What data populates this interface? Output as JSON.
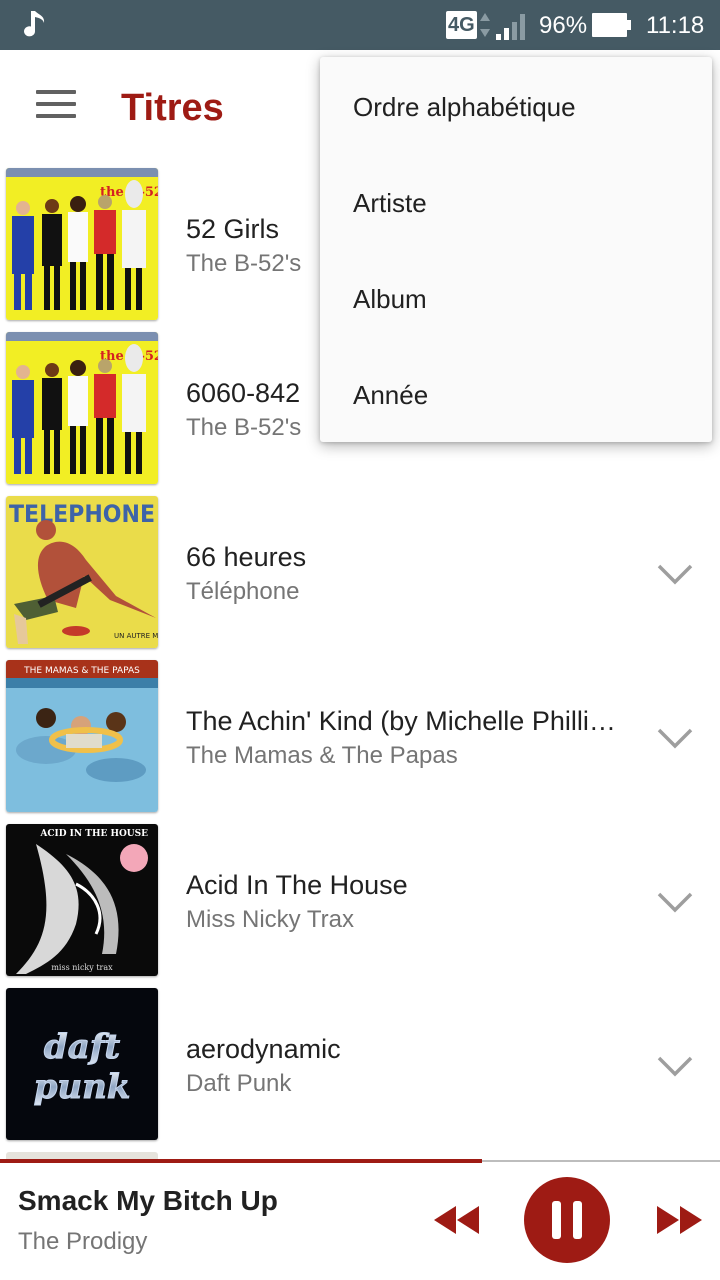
{
  "status_bar": {
    "network": "4G",
    "battery": "96%",
    "time": "11:18",
    "icons": [
      "music-note-icon",
      "signal-icon",
      "battery-icon"
    ]
  },
  "app_bar": {
    "title": "Titres",
    "menu_icon": "hamburger-menu-icon"
  },
  "songs": [
    {
      "title": "52 Girls",
      "artist": "The B-52's",
      "cover": "b52s-cover"
    },
    {
      "title": "6060-842",
      "artist": "The B-52's",
      "cover": "b52s-cover"
    },
    {
      "title": "66 heures",
      "artist": "Téléphone",
      "cover": "telephone-cover",
      "cover_text": "TELEPHONE"
    },
    {
      "title": "The Achin' Kind  (by Michelle Phillips)",
      "artist": "The Mamas & The Papas",
      "cover": "mamas-papas-cover",
      "cover_text": "THE MAMAS & THE PAPAS"
    },
    {
      "title": "Acid In The House",
      "artist": "Miss Nicky Trax",
      "cover": "acid-house-cover",
      "cover_text": "ACID IN THE HOUSE"
    },
    {
      "title": "aerodynamic",
      "artist": "Daft Punk",
      "cover": "daft-punk-cover"
    }
  ],
  "sort_menu": {
    "items": [
      "Ordre alphabétique",
      "Artiste",
      "Album",
      "Année"
    ]
  },
  "now_playing": {
    "title": "Smack My Bitch Up",
    "artist": "The Prodigy",
    "progress_percent": 67,
    "controls": [
      "rewind-icon",
      "pause-icon",
      "fast-forward-icon"
    ]
  },
  "colors": {
    "accent": "#9e1b14",
    "status_bar": "#455a64",
    "secondary_text": "#757575"
  }
}
